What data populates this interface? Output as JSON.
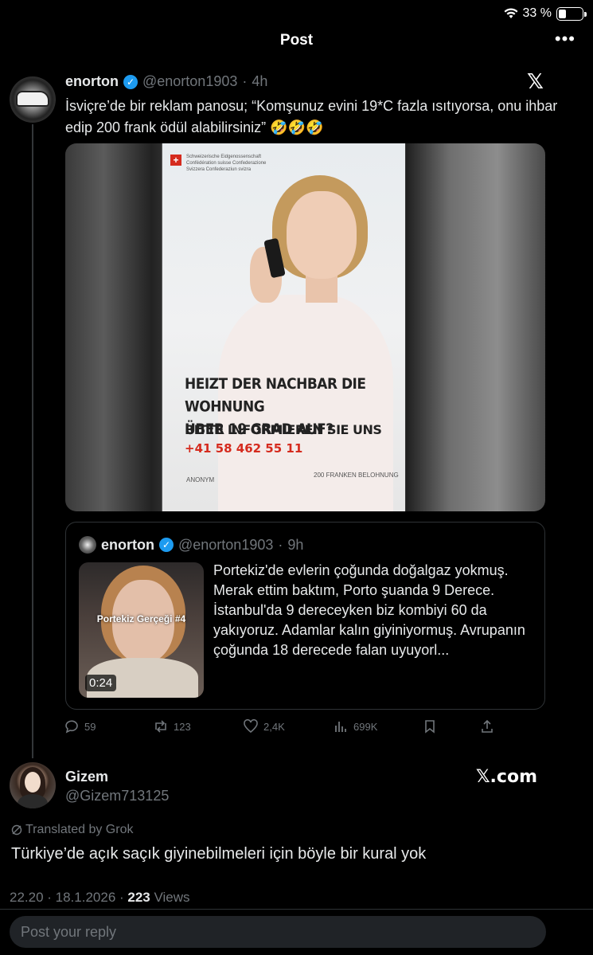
{
  "status_bar": {
    "battery": "33 %",
    "battery_level": 0.33
  },
  "header": {
    "title": "Post",
    "more": "•••"
  },
  "post": {
    "name": "enorton",
    "handle": "@enorton1903",
    "dot": "·",
    "time": "4h",
    "x_logo": "𝕏",
    "text": "İsviçre’de bir reklam panosu;  “Komşunuz evini 19*C fazla ısıtıyorsa, onu ihbar edip 200 frank ödül alabilirsiniz” 🤣🤣🤣",
    "poster": {
      "confederation": "Schweizerische Eidgenossenschaft Confédération suisse Confederazione Svizzera Confederaziun svizra",
      "headline_line1": "HEIZT DER NACHBAR DIE WOHNUNG",
      "headline_line2": "ÜBER 19 GRAD AUF?",
      "cta": "BITTE INFORMIEREN SIE UNS",
      "phone": "+41 58 462 55 11",
      "anon": "ANONYM",
      "reward": "200 FRANKEN BELOHNUNG"
    },
    "quote": {
      "name": "enorton",
      "handle": "@enorton1903",
      "dot": "·",
      "time": "9h",
      "thumb_label": "Portekiz Gerçeği #4",
      "duration": "0:24",
      "text": "Portekiz'de evlerin çoğunda doğalgaz yokmuş. Merak ettim baktım, Porto şuanda 9 Derece. İstanbul'da 9 dereceyken biz kombiyi 60 da yakıyoruz. Adamlar kalın giyiniyormuş. Avrupanın çoğunda 18 derecede falan uyuyorl..."
    },
    "actions": {
      "replies": "59",
      "reposts": "123",
      "likes": "2,4K",
      "views": "699K"
    }
  },
  "reply": {
    "name": "Gizem",
    "handle": "@Gizem713125",
    "xcom": "𝕏.com",
    "translated_label": "Translated by Grok",
    "text": "Türkiye’de açık saçık giyinebilmeleri için böyle bir kural yok",
    "meta_time": "22.20 · 18.1.2026 · ",
    "meta_views_count": "223",
    "meta_views_label": " Views"
  },
  "reply_box": {
    "placeholder": "Post your reply"
  }
}
